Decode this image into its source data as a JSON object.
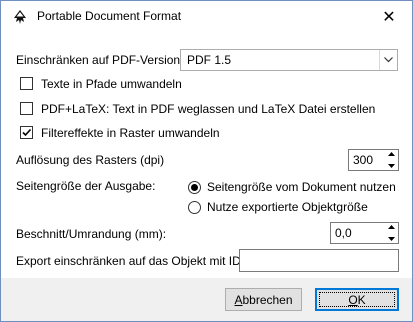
{
  "window": {
    "title": "Portable Document Format",
    "close_glyph": "✕"
  },
  "pdf_version": {
    "label": "Einschränken auf PDF-Version:",
    "selected": "PDF 1.5"
  },
  "checkboxes": [
    {
      "label": "Texte in Pfade umwandeln",
      "checked": false
    },
    {
      "label": "PDF+LaTeX: Text in PDF weglassen und LaTeX Datei erstellen",
      "checked": false
    },
    {
      "label": "Filtereffekte in Raster umwandeln",
      "checked": true
    }
  ],
  "resolution": {
    "label": "Auflösung des Rasters (dpi)",
    "value": "300"
  },
  "page_size": {
    "label": "Seitengröße der Ausgabe:",
    "options": [
      {
        "label": "Seitengröße vom Dokument nutzen",
        "selected": true
      },
      {
        "label": "Nutze exportierte Objektgröße",
        "selected": false
      }
    ]
  },
  "bleed": {
    "label": "Beschnitt/Umrandung (mm):",
    "value": "0,0"
  },
  "export_id": {
    "label": "Export einschränken auf das Objekt mit ID",
    "value": ""
  },
  "buttons": {
    "cancel_pre": "",
    "cancel_ul": "A",
    "cancel_post": "bbrechen",
    "ok_ul": "O",
    "ok_post": "K"
  }
}
